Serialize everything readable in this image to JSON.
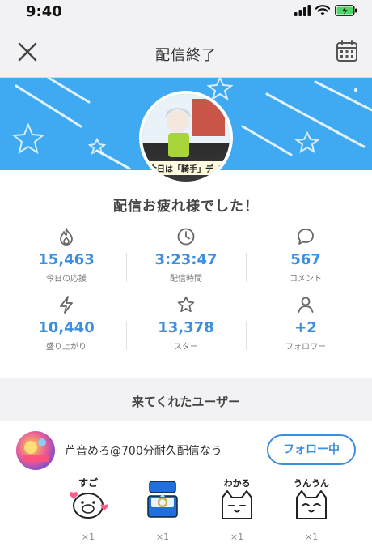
{
  "status_bar": {
    "time": "9:40"
  },
  "nav": {
    "title": "配信終了"
  },
  "banner": {
    "accent_color": "#3fa9f2",
    "avatar_caption": "今日は「騎手」デノ"
  },
  "thanks_message": "配信お疲れ様でした！",
  "stats": [
    {
      "icon": "flame-icon",
      "value": "15,463",
      "label": "今日の応援"
    },
    {
      "icon": "clock-icon",
      "value": "3:23:47",
      "label": "配信時間"
    },
    {
      "icon": "comment-icon",
      "value": "567",
      "label": "コメント"
    },
    {
      "icon": "bolt-icon",
      "value": "10,440",
      "label": "盛り上がり"
    },
    {
      "icon": "star-icon",
      "value": "13,378",
      "label": "スター"
    },
    {
      "icon": "person-icon",
      "value": "+2",
      "label": "フォロワー"
    }
  ],
  "users_section": {
    "title": "来てくれたユーザー"
  },
  "user": {
    "name": "芦音めろ@700分耐久配信なう",
    "follow_label": "フォロー中"
  },
  "stickers": [
    {
      "icon": "pig-sugoi-sticker-icon",
      "text": "すご",
      "count": "×1"
    },
    {
      "icon": "ring-box-sticker-icon",
      "count": "×1"
    },
    {
      "icon": "cat-wakaru-sticker-icon",
      "text": "わかる",
      "count": "×1"
    },
    {
      "icon": "cat-unun-sticker-icon",
      "text": "うんうん",
      "count": "×1"
    }
  ],
  "colors": {
    "accent": "#3c8ee0",
    "background_gray": "#f2f2f4"
  }
}
